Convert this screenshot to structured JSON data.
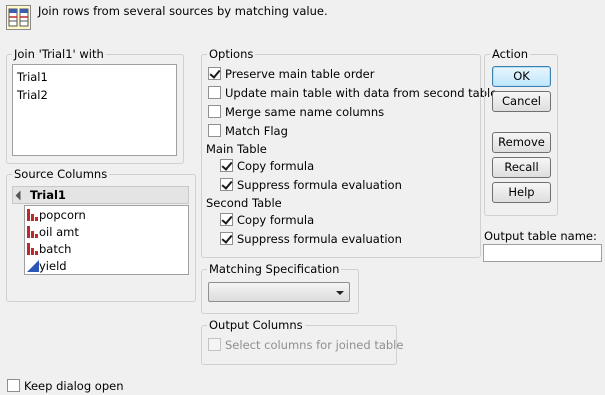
{
  "header": {
    "description": "Join rows from several sources by matching value."
  },
  "join_group": {
    "legend": "Join 'Trial1' with",
    "items": [
      "Trial1",
      "Trial2"
    ]
  },
  "source_columns": {
    "legend": "Source Columns",
    "table_name": "Trial1",
    "columns": [
      {
        "name": "popcorn",
        "icon": "nominal-bar-icon"
      },
      {
        "name": "oil amt",
        "icon": "nominal-bar-icon"
      },
      {
        "name": "batch",
        "icon": "nominal-bar-icon"
      },
      {
        "name": "yield",
        "icon": "continuous-triangle-icon"
      }
    ]
  },
  "options": {
    "legend": "Options",
    "preserve_order": {
      "label": "Preserve main table order",
      "checked": true
    },
    "update_main": {
      "label": "Update main table with data from second table",
      "checked": false
    },
    "merge_same": {
      "label": "Merge same name columns",
      "checked": false
    },
    "match_flag": {
      "label": "Match Flag",
      "checked": false
    },
    "main_table": {
      "heading": "Main Table",
      "copy_formula": {
        "label": "Copy formula",
        "checked": true
      },
      "suppress_eval": {
        "label": "Suppress formula evaluation",
        "checked": true
      }
    },
    "second_table": {
      "heading": "Second Table",
      "copy_formula": {
        "label": "Copy formula",
        "checked": true
      },
      "suppress_eval": {
        "label": "Suppress formula evaluation",
        "checked": true
      }
    }
  },
  "action": {
    "legend": "Action",
    "ok": "OK",
    "cancel": "Cancel",
    "remove": "Remove",
    "recall": "Recall",
    "help": "Help"
  },
  "output_table_name": {
    "label": "Output table name:",
    "value": ""
  },
  "matching": {
    "legend": "Matching Specification",
    "selected": ""
  },
  "output_columns": {
    "legend": "Output Columns",
    "select_columns": {
      "label": "Select columns for joined table",
      "checked": false,
      "enabled": false
    }
  },
  "keep_open": {
    "label": "Keep dialog open",
    "checked": false
  },
  "colors": {
    "nominal": "#c0292b",
    "continuous": "#2a56b8",
    "default_button_border": "#3c7fb1"
  }
}
